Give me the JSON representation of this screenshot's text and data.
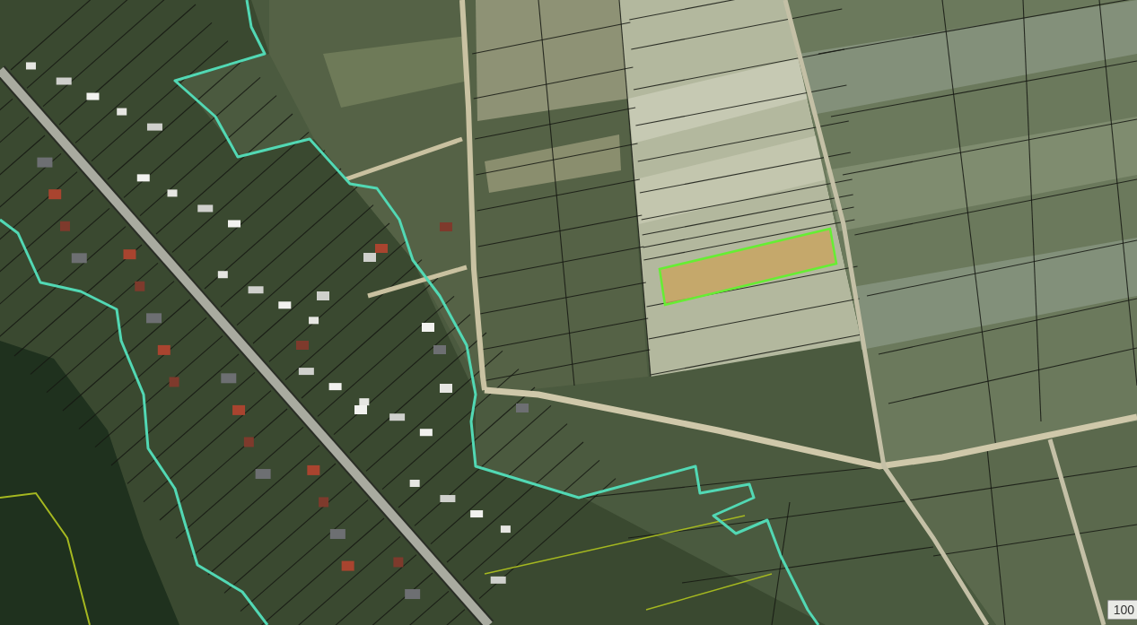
{
  "map": {
    "scale_bar": {
      "label": "100"
    }
  }
}
